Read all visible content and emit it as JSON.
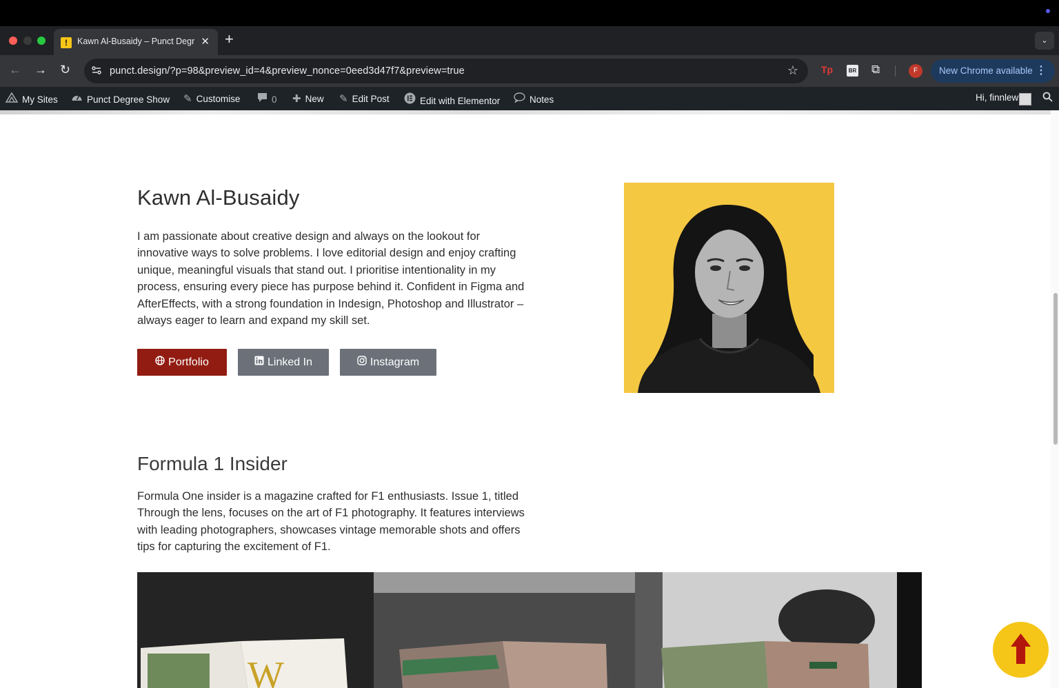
{
  "browser": {
    "tab_title": "Kawn Al-Busaidy – Punct Degree Show",
    "tab_favicon": "!",
    "url": "punct.design/?p=98&preview_id=4&preview_nonce=0eed3d47f7&preview=true",
    "update_label": "New Chrome available",
    "profile_initial": "F",
    "ext_tp": "Tp",
    "ext_br": "BR"
  },
  "adminbar": {
    "my_sites": "My Sites",
    "site_name": "Punct Degree Show",
    "customise": "Customise",
    "comments_count": "0",
    "new": "New",
    "edit_post": "Edit Post",
    "edit_elementor": "Edit with Elementor",
    "notes": "Notes",
    "greeting": "Hi, finnlewis"
  },
  "profile": {
    "name": "Kawn Al-Busaidy",
    "bio": " I am passionate about creative design and always on the lookout for innovative ways to solve problems. I love editorial design and enjoy crafting unique, meaningful visuals that stand out. I prioritise intentionality in my process, ensuring every piece has purpose behind it. Confident in Figma and AfterEffects, with a strong foundation in Indesign, Photoshop and Illustrator – always eager to learn and expand my skill set.",
    "buttons": {
      "portfolio": "Portfolio",
      "linkedin": "Linked In",
      "instagram": "Instagram"
    }
  },
  "project": {
    "title": "Formula 1 Insider",
    "description": "Formula One insider is a magazine crafted for F1 enthusiasts. Issue 1, titled Through the lens, focuses on the art of F1 photography. It features interviews with leading photographers, showcases vintage memorable shots and offers tips for capturing the excitement of F1."
  },
  "colors": {
    "accent": "#921c12",
    "secondary_button": "#6b7079",
    "portrait_bg": "#f5c842",
    "scroll_top_bg": "#f5c518",
    "scroll_top_arrow": "#b3160c"
  }
}
